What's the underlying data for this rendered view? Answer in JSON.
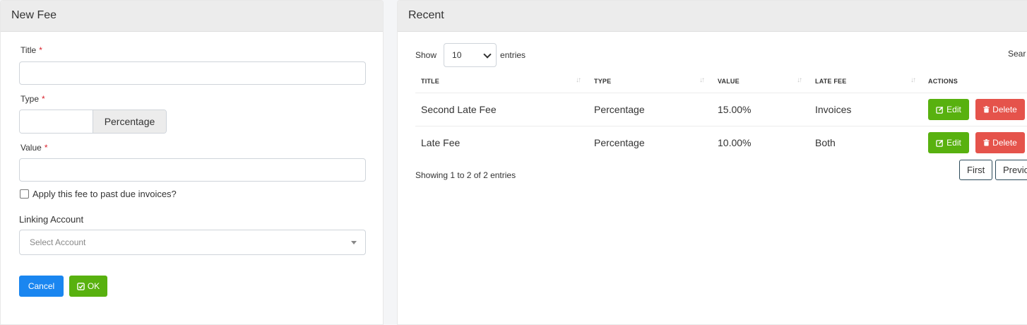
{
  "new_fee": {
    "header": "New Fee",
    "title_label": "Title",
    "type_label": "Type",
    "type_addon": "Percentage",
    "value_label": "Value",
    "required_mark": "*",
    "checkbox_label": "Apply this fee to past due invoices?",
    "linking_account_label": "Linking Account",
    "linking_account_placeholder": "Select Account",
    "cancel_label": "Cancel",
    "ok_label": "OK"
  },
  "recent": {
    "header": "Recent",
    "show_label": "Show",
    "page_length": "10",
    "entries_label": "entries",
    "search_label": "Sear",
    "columns": [
      "TITLE",
      "TYPE",
      "VALUE",
      "LATE FEE",
      "ACTIONS"
    ],
    "rows": [
      {
        "title": "Second Late Fee",
        "type": "Percentage",
        "value": "15.00%",
        "late_fee": "Invoices"
      },
      {
        "title": "Late Fee",
        "type": "Percentage",
        "value": "10.00%",
        "late_fee": "Both"
      }
    ],
    "edit_label": "Edit",
    "delete_label": "Delete",
    "info": "Showing 1 to 2 of 2 entries",
    "pagination": {
      "first": "First",
      "previous": "Previo"
    }
  },
  "colors": {
    "primary": "#1a86f0",
    "success": "#58b10f",
    "danger": "#e5534b",
    "header_bg": "#ececec"
  }
}
